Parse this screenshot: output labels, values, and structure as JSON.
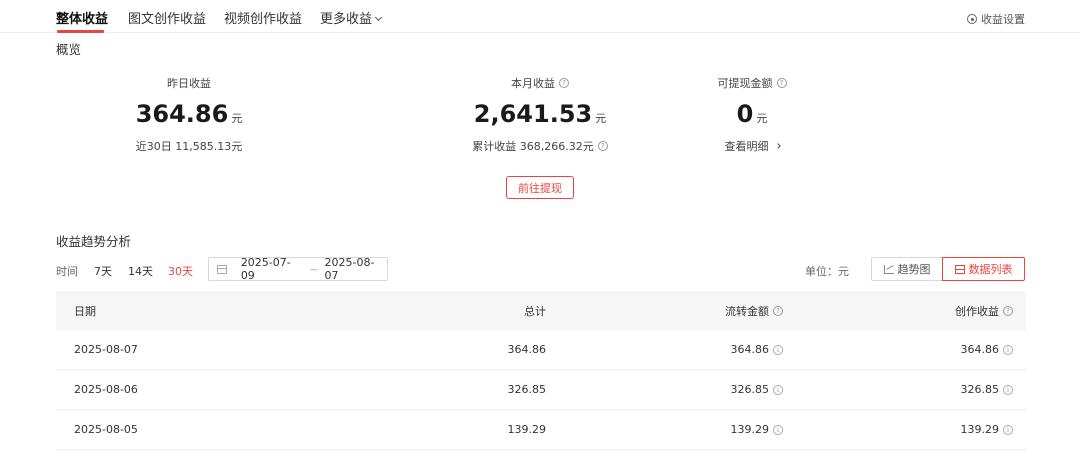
{
  "tabs": [
    {
      "label": "整体收益",
      "active": true
    },
    {
      "label": "图文创作收益",
      "active": false
    },
    {
      "label": "视频创作收益",
      "active": false
    },
    {
      "label": "更多收益",
      "active": false
    }
  ],
  "settings_label": "收益设置",
  "overview": {
    "title": "概览",
    "stats": [
      {
        "label": "昨日收益",
        "value": "364.86",
        "unit": "元",
        "sub": "近30日 11,585.13元"
      },
      {
        "label": "本月收益",
        "value": "2,641.53",
        "unit": "元",
        "sub": "累计收益 368,266.32元"
      },
      {
        "label": "可提现金额",
        "value": "0",
        "unit": "元",
        "sub": "查看明细"
      }
    ],
    "withdraw_button": "前往提现"
  },
  "trend": {
    "title": "收益趋势分析",
    "time_label": "时间",
    "ranges": [
      "7天",
      "14天",
      "30天"
    ],
    "active_range": "30天",
    "date_start": "2025-07-09",
    "date_sep": "~",
    "date_end": "2025-08-07",
    "unit_label": "单位：元",
    "view_chart": "趋势图",
    "view_list": "数据列表",
    "active_view": "数据列表"
  },
  "table": {
    "headers": [
      "日期",
      "总计",
      "流转金额",
      "创作收益"
    ],
    "rows": [
      [
        "2025-08-07",
        "364.86",
        "364.86",
        "364.86"
      ],
      [
        "2025-08-06",
        "326.85",
        "326.85",
        "326.85"
      ],
      [
        "2025-08-05",
        "139.29",
        "139.29",
        "139.29"
      ]
    ]
  },
  "colors": {
    "accent": "#e8453c",
    "header_bg": "#f6f6f7",
    "border": "#ececec"
  },
  "icons": [
    "gear-icon",
    "question-icon",
    "info-icon",
    "calendar-icon",
    "trend-chart-icon",
    "list-icon",
    "chevron-down-icon",
    "chevron-right-icon"
  ]
}
